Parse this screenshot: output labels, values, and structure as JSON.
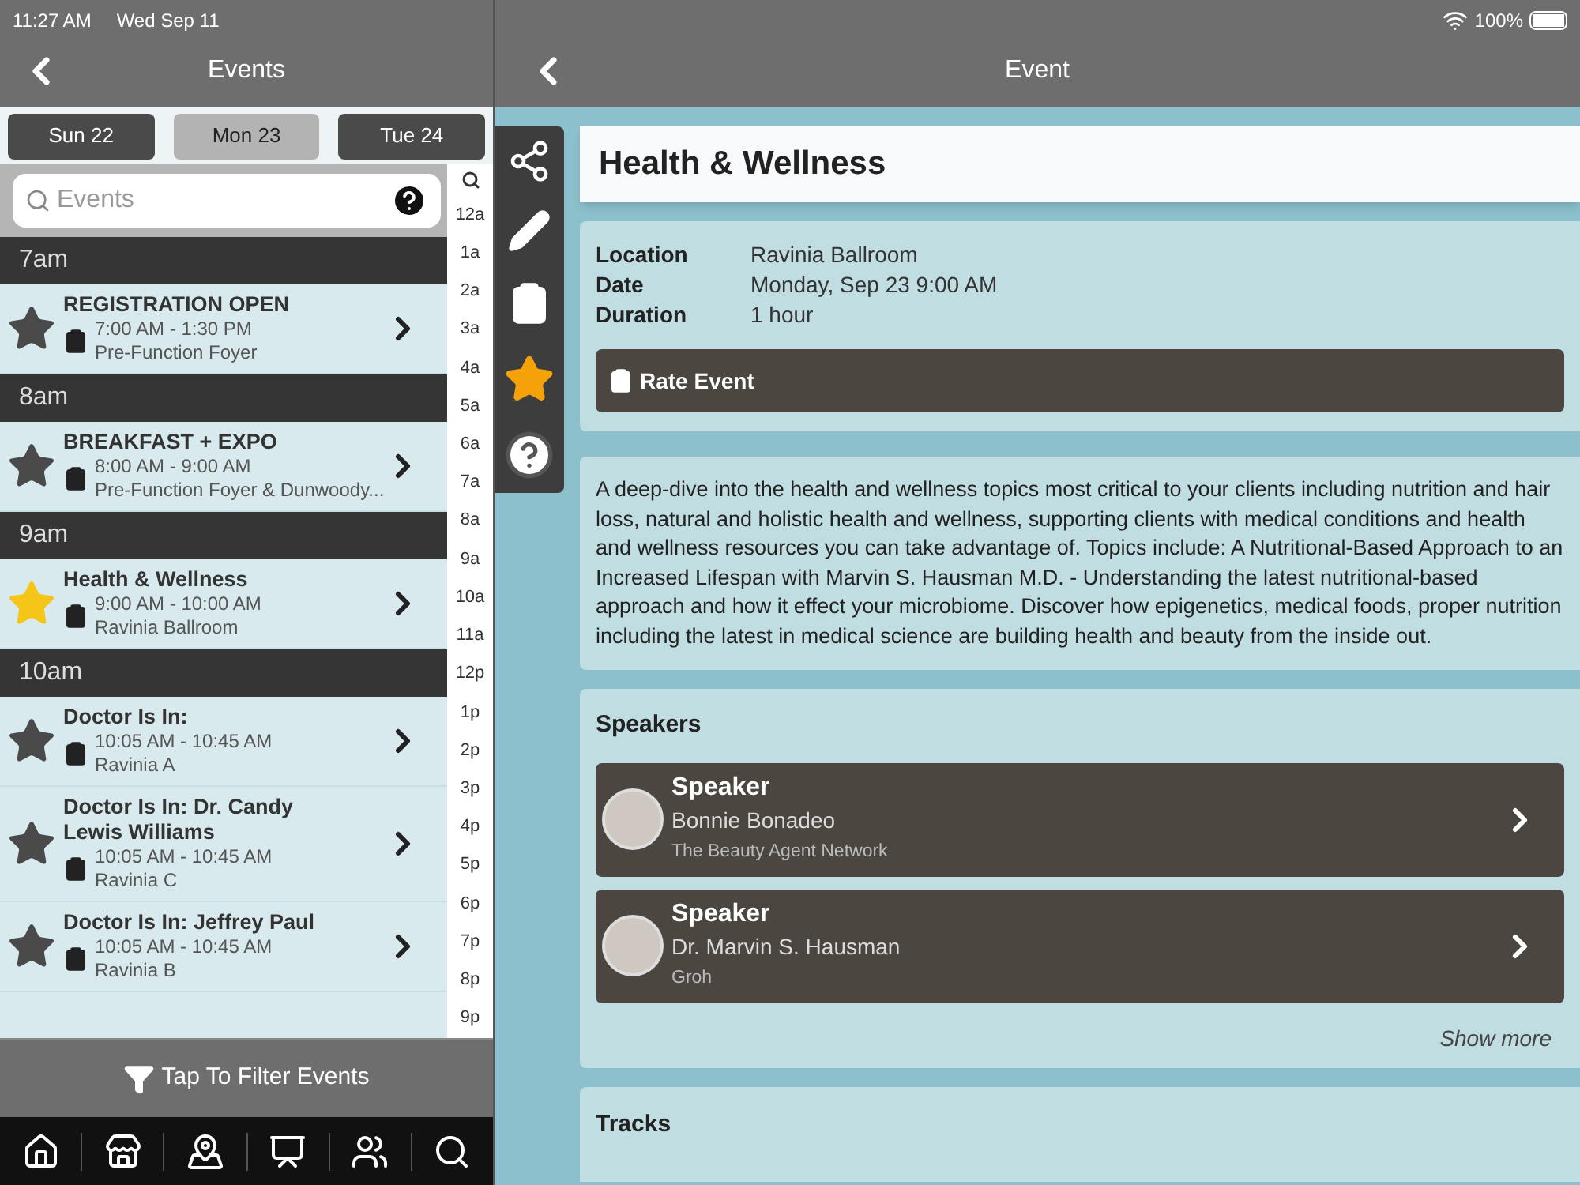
{
  "status_bar": {
    "time": "11:27 AM",
    "date": "Wed Sep 11",
    "battery": "100%"
  },
  "left_header": {
    "title": "Events"
  },
  "day_tabs": [
    {
      "label": "Sun 22",
      "selected": false
    },
    {
      "label": "Mon 23",
      "selected": true
    },
    {
      "label": "Tue 24",
      "selected": false
    }
  ],
  "search": {
    "placeholder": "Events"
  },
  "schedule": [
    {
      "hour": "7am",
      "events": [
        {
          "title": "REGISTRATION OPEN",
          "time": "7:00 AM - 1:30 PM",
          "location": "Pre-Function Foyer",
          "starred": false
        }
      ]
    },
    {
      "hour": "8am",
      "events": [
        {
          "title": "BREAKFAST + EXPO",
          "time": "8:00 AM - 9:00 AM",
          "location": "Pre-Function Foyer & Dunwoody...",
          "starred": false
        }
      ]
    },
    {
      "hour": "9am",
      "events": [
        {
          "title": "Health & Wellness",
          "time": "9:00 AM - 10:00 AM",
          "location": "Ravinia Ballroom",
          "starred": true
        }
      ]
    },
    {
      "hour": "10am",
      "events": [
        {
          "title": "Doctor Is In:",
          "time": "10:05 AM - 10:45 AM",
          "location": "Ravinia A",
          "starred": false
        },
        {
          "title": "Doctor Is In: Dr. Candy Lewis Williams",
          "time": "10:05 AM - 10:45 AM",
          "location": "Ravinia C",
          "starred": false
        },
        {
          "title": "Doctor Is In: Jeffrey Paul",
          "time": "10:05 AM - 10:45 AM",
          "location": "Ravinia B",
          "starred": false
        }
      ]
    }
  ],
  "hour_index": [
    "12a",
    "1a",
    "2a",
    "3a",
    "4a",
    "5a",
    "6a",
    "7a",
    "8a",
    "9a",
    "10a",
    "11a",
    "12p",
    "1p",
    "2p",
    "3p",
    "4p",
    "5p",
    "6p",
    "7p",
    "8p",
    "9p"
  ],
  "filter_bar": {
    "label": "Tap To Filter Events"
  },
  "right_header": {
    "title": "Event"
  },
  "event": {
    "title": "Health & Wellness",
    "starred": true,
    "details": [
      {
        "label": "Location",
        "value": "Ravinia Ballroom"
      },
      {
        "label": "Date",
        "value": "Monday, Sep 23 9:00 AM"
      },
      {
        "label": "Duration",
        "value": "1 hour"
      }
    ],
    "rate_button": "Rate Event",
    "description": "A deep-dive into the health and wellness topics most critical to your clients including nutrition and hair loss, natural and holistic health and wellness, supporting clients with medical conditions and health and wellness resources you can take advantage of. Topics include: A Nutritional-Based Approach to an Increased Lifespan with Marvin S. Hausman M.D. - Understanding the latest nutritional-based approach and how it effect your microbiome. Discover how epigenetics, medical foods, proper nutrition including the latest in medical science are building health and beauty from the inside out."
  },
  "speakers": {
    "heading": "Speakers",
    "items": [
      {
        "role": "Speaker",
        "name": "Bonnie Bonadeo",
        "company": "The Beauty Agent Network"
      },
      {
        "role": "Speaker",
        "name": "Dr. Marvin S. Hausman",
        "company": "Groh"
      }
    ],
    "show_more": "Show more"
  },
  "tracks": {
    "heading": "Tracks"
  }
}
